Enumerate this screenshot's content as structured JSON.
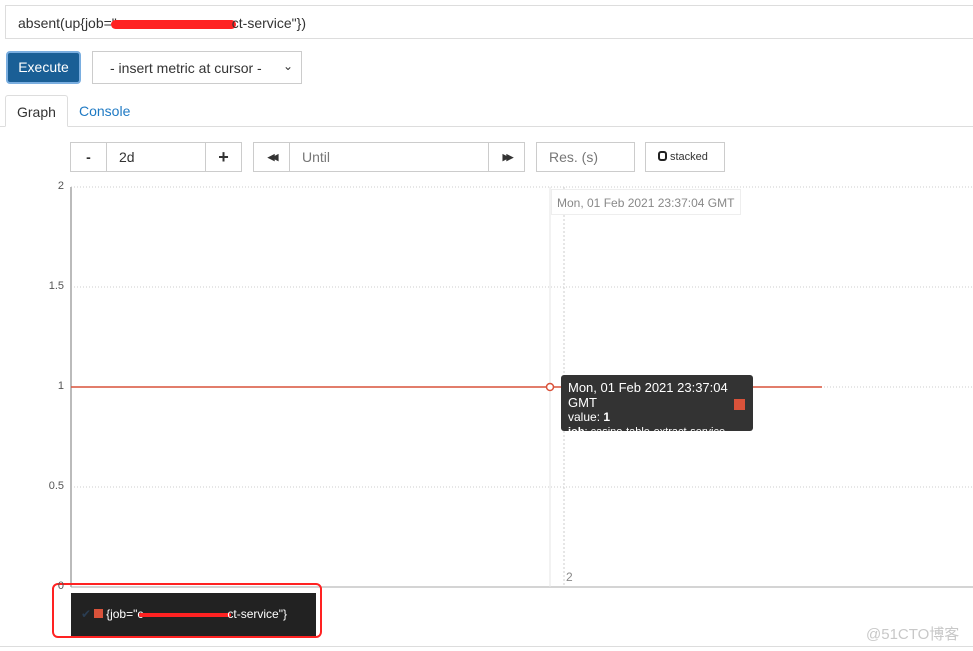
{
  "query": {
    "prefix": "absent(up{job=\"",
    "suffix": "ct-service\"})"
  },
  "toolbar": {
    "execute_label": "Execute",
    "metric_select": "- insert metric at cursor -"
  },
  "tabs": [
    {
      "label": "Graph",
      "active": true
    },
    {
      "label": "Console",
      "active": false
    }
  ],
  "graph_controls": {
    "minus": "-",
    "range": "2d",
    "plus": "+",
    "back": "◀◀",
    "until_placeholder": "Until",
    "forward": "▶▶",
    "res_placeholder": "Res. (s)",
    "stacked_label": "stacked"
  },
  "chart_data": {
    "type": "line",
    "ylim": [
      0,
      2
    ],
    "yticks": [
      "0",
      "0.5",
      "1",
      "1.5",
      "2"
    ],
    "grid": true,
    "series": [
      {
        "color": "#d9523a",
        "values": [
          1
        ]
      }
    ],
    "hover_time": "Mon, 01 Feb 2021 23:37:04 GMT",
    "x_tick_label": "2"
  },
  "tooltip": {
    "time": "Mon, 01 Feb 2021 23:37:04 GMT",
    "value_label": "value: ",
    "value": "1",
    "job_key": "job",
    "job_value": ": casino-table-extract-service"
  },
  "legend": {
    "prefix": "{job=\"c",
    "suffix": "ct-service\"}",
    "color": "#d9523a"
  },
  "watermark": "@51CTO博客"
}
